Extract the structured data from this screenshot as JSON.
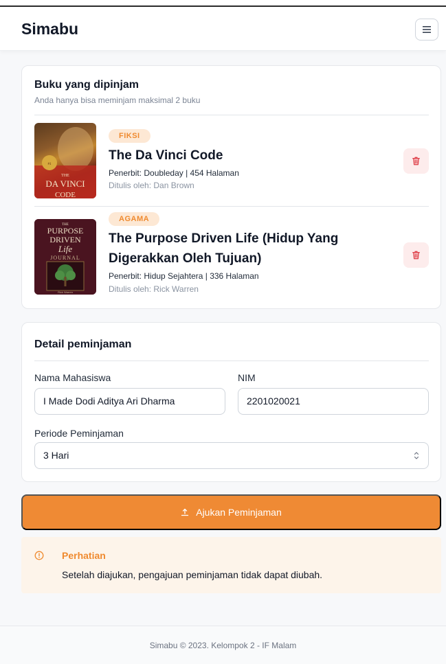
{
  "header": {
    "brand": "Simabu",
    "menu_icon": "hamburger-menu-icon"
  },
  "borrowed": {
    "title": "Buku yang dipinjam",
    "subtitle": "Anda hanya bisa meminjam maksimal 2 buku",
    "books": [
      {
        "category": "FIKSI",
        "title": "The Da Vinci Code",
        "meta": "Penerbit: Doubleday | 454 Halaman",
        "author": "Ditulis oleh: Dan Brown",
        "cover_text_1": "THE",
        "cover_text_2": "DA VINCI",
        "cover_text_3": "CODE",
        "delete_icon": "trash-icon"
      },
      {
        "category": "AGAMA",
        "title_line1": "The Purpose Driven Life (Hidup Yang",
        "title_line2": "Digerakkan Oleh Tujuan)",
        "meta": "Penerbit: Hidup Sejahtera | 336 Halaman",
        "author": "Ditulis oleh: Rick Warren",
        "cover_text_1": "THE",
        "cover_text_2": "PURPOSE",
        "cover_text_3": "DRIVEN",
        "cover_text_4": "Life",
        "cover_text_5": "JOURNAL",
        "delete_icon": "trash-icon"
      }
    ]
  },
  "detail": {
    "title": "Detail peminjaman",
    "name_label": "Nama Mahasiswa",
    "name_value": "I Made Dodi Aditya Ari Dharma",
    "nim_label": "NIM",
    "nim_value": "2201020021",
    "period_label": "Periode Peminjaman",
    "period_value": "3 Hari"
  },
  "submit": {
    "label": "Ajukan Peminjaman",
    "icon": "upload-icon"
  },
  "alert": {
    "title": "Perhatian",
    "text": "Setelah diajukan, pengajuan peminjaman tidak dapat diubah.",
    "icon": "alert-circle-icon"
  },
  "footer": {
    "text": "Simabu © 2023. Kelompok 2 - IF Malam"
  },
  "colors": {
    "accent": "#ef8a34",
    "badge_bg": "#fde8d4",
    "danger": "#e0464f",
    "alert_bg": "#fdf4ea"
  }
}
